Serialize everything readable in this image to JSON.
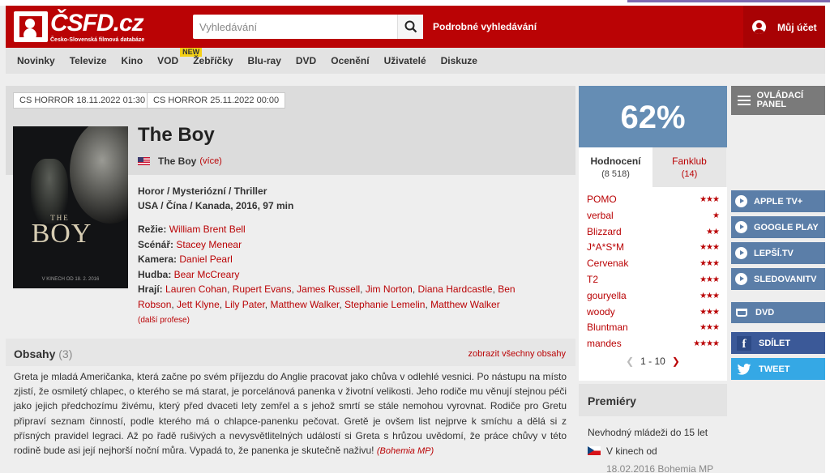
{
  "site": {
    "logo_main": "ČSFD.cz",
    "logo_sub": "Česko-Slovenská filmová databáze",
    "search_placeholder": "Vyhledávání",
    "advanced_search": "Podrobné vyhledávání",
    "account": "Můj účet"
  },
  "nav": {
    "items": [
      "Novinky",
      "Televize",
      "Kino",
      "VOD",
      "Žebříčky",
      "Blu-ray",
      "DVD",
      "Ocenění",
      "Uživatelé",
      "Diskuze"
    ],
    "vod_badge": "NEW"
  },
  "airings": [
    "CS HORROR 18.11.2022 01:30",
    "CS HORROR 25.11.2022 00:00"
  ],
  "poster": {
    "the": "THE",
    "boy": "BOY",
    "footer": "V KINECH OD 18. 2. 2016"
  },
  "film": {
    "title": "The Boy",
    "alt_title": "The Boy",
    "alt_more": "(více)",
    "genres": "Horor / Mysteriózní / Thriller",
    "origin": "USA / Čína / Kanada, 2016, 97 min",
    "crew": {
      "direction_label": "Režie:",
      "direction": "William Brent Bell",
      "writer_label": "Scénář:",
      "writer": "Stacey Menear",
      "camera_label": "Kamera:",
      "camera": "Daniel Pearl",
      "music_label": "Hudba:",
      "music": "Bear McCreary",
      "cast_label": "Hrají:",
      "cast": [
        "Lauren Cohan",
        "Rupert Evans",
        "James Russell",
        "Jim Norton",
        "Diana Hardcastle",
        "Ben Robson",
        "Jett Klyne",
        "Lily Pater",
        "Matthew Walker",
        "Stephanie Lemelin",
        "Matthew Walker"
      ],
      "more_roles": "(další profese)"
    }
  },
  "plot": {
    "title": "Obsahy",
    "count": "(3)",
    "show_all": "zobrazit všechny obsahy",
    "text": "Greta je mladá Američanka, která začne po svém příjezdu do Anglie pracovat jako chůva v odlehlé vesnici. Po nástupu na místo zjistí, že osmiletý chlapec, o kterého se má starat, je porcelánová panenka v životní velikosti. Jeho rodiče mu věnují stejnou péči jako jejich předchozímu živému, který před dvaceti lety zemřel a s jehož smrtí se stále nemohou vyrovnat. Rodiče pro Gretu připraví seznam činností, podle kterého má o chlapce-panenku pečovat. Gretě je ovšem list nejprve k smíchu a dělá si z přísných pravidel legraci. Až po řadě rušivých a nevysvětlitelných událostí si Greta s hrůzou uvědomí, že práce chůvy v této rodině bude asi její nejhorší noční můra. Vypadá to, že panenka je skutečně naživu!",
    "source": "(Bohemia MP)"
  },
  "rating": {
    "score": "62%",
    "tab_ratings": "Hodnocení",
    "tab_ratings_count": "(8 518)",
    "tab_fanclub": "Fanklub",
    "tab_fanclub_count": "(14)",
    "users": [
      {
        "name": "POMO",
        "stars": 3
      },
      {
        "name": "verbal",
        "stars": 1
      },
      {
        "name": "Blizzard",
        "stars": 2
      },
      {
        "name": "J*A*S*M",
        "stars": 3
      },
      {
        "name": "Cervenak",
        "stars": 3
      },
      {
        "name": "T2",
        "stars": 3
      },
      {
        "name": "gouryella",
        "stars": 3
      },
      {
        "name": "woody",
        "stars": 3
      },
      {
        "name": "Bluntman",
        "stars": 3
      },
      {
        "name": "mandes",
        "stars": 4
      }
    ],
    "pager": "1 - 10"
  },
  "premiery": {
    "title": "Premiéry",
    "age": "Nevhodný mládeži do 15 let",
    "cinema": "V kinech od",
    "date": "18.02.2016 Bohemia MP"
  },
  "sidebar": {
    "panel": "OVLÁDACÍ PANEL",
    "vod": [
      "APPLE TV+",
      "GOOGLE PLAY",
      "LEPŠÍ.TV",
      "SLEDOVANITV"
    ],
    "dvd": "DVD",
    "share": "SDÍLET",
    "tweet": "TWEET"
  },
  "colors": {
    "brand_red": "#ba0305",
    "score_blue": "#658db4",
    "facebook": "#3b5998",
    "twitter": "#35a8e5"
  }
}
